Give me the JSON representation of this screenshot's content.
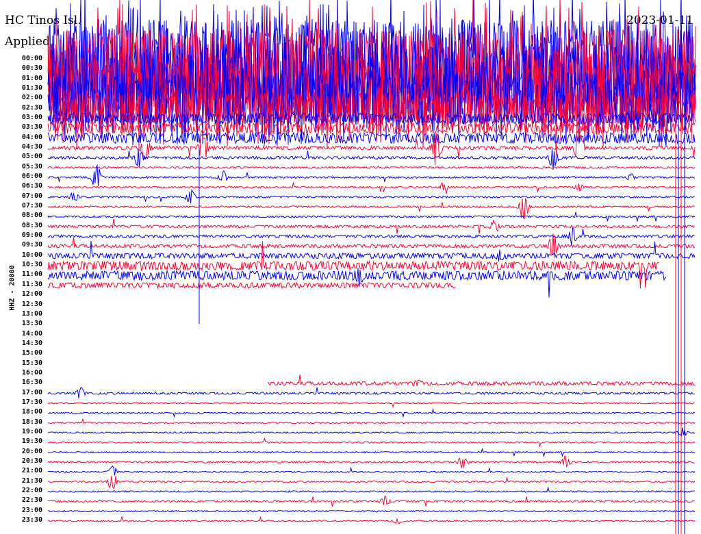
{
  "header": {
    "station": "HC Tinos Isl.",
    "filter_note": "Applied",
    "date": "2023-01-11"
  },
  "chart_data": {
    "type": "line",
    "title": "HC Tinos Isl.",
    "ylabel": "HHZ - 20000",
    "colors": {
      "hour": "#0000ff",
      "half_hour": "#ff0033"
    },
    "rows": [
      {
        "label": "00:00",
        "amp": 45,
        "start": 0,
        "end": 1,
        "events": []
      },
      {
        "label": "00:30",
        "amp": 45,
        "start": 0,
        "end": 1,
        "events": []
      },
      {
        "label": "01:00",
        "amp": 40,
        "start": 0,
        "end": 1,
        "events": []
      },
      {
        "label": "01:30",
        "amp": 38,
        "start": 0,
        "end": 1,
        "events": []
      },
      {
        "label": "02:00",
        "amp": 30,
        "start": 0,
        "end": 1,
        "events": []
      },
      {
        "label": "02:30",
        "amp": 18,
        "start": 0,
        "end": 1,
        "events": []
      },
      {
        "label": "03:00",
        "amp": 6,
        "start": 0,
        "end": 1,
        "events": []
      },
      {
        "label": "03:30",
        "amp": 6,
        "start": 0,
        "end": 1,
        "events": []
      },
      {
        "label": "04:00",
        "amp": 6,
        "start": 0,
        "end": 1,
        "events": []
      },
      {
        "label": "04:30",
        "amp": 2,
        "start": 0,
        "end": 1,
        "events": [
          [
            0.15,
            12
          ],
          [
            0.24,
            20
          ],
          [
            0.6,
            18
          ],
          [
            0.82,
            22
          ]
        ]
      },
      {
        "label": "05:00",
        "amp": 1.5,
        "start": 0,
        "end": 1,
        "events": [
          [
            0.14,
            10
          ],
          [
            0.78,
            12
          ]
        ]
      },
      {
        "label": "05:30",
        "amp": 1,
        "start": 0,
        "end": 1,
        "events": []
      },
      {
        "label": "06:00",
        "amp": 1,
        "start": 0,
        "end": 1,
        "events": [
          [
            0.075,
            14
          ],
          [
            0.27,
            6
          ],
          [
            0.9,
            3
          ]
        ]
      },
      {
        "label": "06:30",
        "amp": 1,
        "start": 0,
        "end": 1,
        "events": [
          [
            0.61,
            4
          ],
          [
            0.82,
            4
          ]
        ]
      },
      {
        "label": "07:00",
        "amp": 1,
        "start": 0,
        "end": 1,
        "events": [
          [
            0.04,
            5
          ],
          [
            0.22,
            8
          ]
        ]
      },
      {
        "label": "07:30",
        "amp": 1,
        "start": 0,
        "end": 1,
        "events": [
          [
            0.735,
            15
          ]
        ]
      },
      {
        "label": "08:00",
        "amp": 1,
        "start": 0,
        "end": 1,
        "events": []
      },
      {
        "label": "08:30",
        "amp": 1.5,
        "start": 0,
        "end": 1,
        "events": [
          [
            0.69,
            6
          ]
        ]
      },
      {
        "label": "09:00",
        "amp": 1.5,
        "start": 0,
        "end": 1,
        "events": [
          [
            0.81,
            9
          ]
        ]
      },
      {
        "label": "09:30",
        "amp": 2,
        "start": 0,
        "end": 1,
        "events": [
          [
            0.78,
            12
          ]
        ]
      },
      {
        "label": "10:00",
        "amp": 3,
        "start": 0,
        "end": 1,
        "events": [
          [
            0.7,
            5
          ]
        ]
      },
      {
        "label": "10:30",
        "amp": 5,
        "start": 0,
        "end": 0.945,
        "events": []
      },
      {
        "label": "11:00",
        "amp": 5,
        "start": 0,
        "end": 0.955,
        "events": [
          [
            0.48,
            8
          ]
        ]
      },
      {
        "label": "11:30",
        "amp": 3,
        "start": 0,
        "end": 0.63,
        "events": []
      },
      {
        "label": "12:00",
        "amp": 0,
        "start": 0,
        "end": 0,
        "events": []
      },
      {
        "label": "12:30",
        "amp": 0,
        "start": 0,
        "end": 0,
        "events": []
      },
      {
        "label": "13:00",
        "amp": 0,
        "start": 0,
        "end": 0,
        "events": []
      },
      {
        "label": "13:30",
        "amp": 0,
        "start": 0,
        "end": 0,
        "events": []
      },
      {
        "label": "14:00",
        "amp": 0,
        "start": 0,
        "end": 0,
        "events": []
      },
      {
        "label": "14:30",
        "amp": 0,
        "start": 0,
        "end": 0,
        "events": []
      },
      {
        "label": "15:00",
        "amp": 0,
        "start": 0,
        "end": 0,
        "events": []
      },
      {
        "label": "15:30",
        "amp": 0,
        "start": 0,
        "end": 0,
        "events": []
      },
      {
        "label": "16:00",
        "amp": 0,
        "start": 0,
        "end": 0,
        "events": []
      },
      {
        "label": "16:30",
        "amp": 2,
        "start": 0.34,
        "end": 1,
        "events": [
          [
            0.57,
            3
          ]
        ]
      },
      {
        "label": "17:00",
        "amp": 1.2,
        "start": 0,
        "end": 1,
        "events": [
          [
            0.05,
            6
          ]
        ]
      },
      {
        "label": "17:30",
        "amp": 0.8,
        "start": 0,
        "end": 1,
        "events": []
      },
      {
        "label": "18:00",
        "amp": 0.8,
        "start": 0,
        "end": 1,
        "events": []
      },
      {
        "label": "18:30",
        "amp": 0.8,
        "start": 0,
        "end": 1,
        "events": []
      },
      {
        "label": "19:00",
        "amp": 0.8,
        "start": 0,
        "end": 1,
        "events": [
          [
            0.98,
            5
          ]
        ]
      },
      {
        "label": "19:30",
        "amp": 0.8,
        "start": 0,
        "end": 1,
        "events": []
      },
      {
        "label": "20:00",
        "amp": 0.8,
        "start": 0,
        "end": 1,
        "events": []
      },
      {
        "label": "20:30",
        "amp": 1,
        "start": 0,
        "end": 1,
        "events": [
          [
            0.64,
            6
          ],
          [
            0.8,
            6
          ]
        ]
      },
      {
        "label": "21:00",
        "amp": 0.8,
        "start": 0,
        "end": 1,
        "events": [
          [
            0.1,
            6
          ]
        ]
      },
      {
        "label": "21:30",
        "amp": 0.8,
        "start": 0,
        "end": 1,
        "events": [
          [
            0.1,
            10
          ]
        ]
      },
      {
        "label": "22:00",
        "amp": 0.8,
        "start": 0,
        "end": 1,
        "events": []
      },
      {
        "label": "22:30",
        "amp": 1,
        "start": 0,
        "end": 1,
        "events": [
          [
            0.52,
            5
          ]
        ]
      },
      {
        "label": "23:00",
        "amp": 0.8,
        "start": 0,
        "end": 1,
        "events": []
      },
      {
        "label": "23:30",
        "amp": 0.8,
        "start": 0,
        "end": 1,
        "events": [
          [
            0.54,
            3
          ]
        ]
      }
    ]
  }
}
